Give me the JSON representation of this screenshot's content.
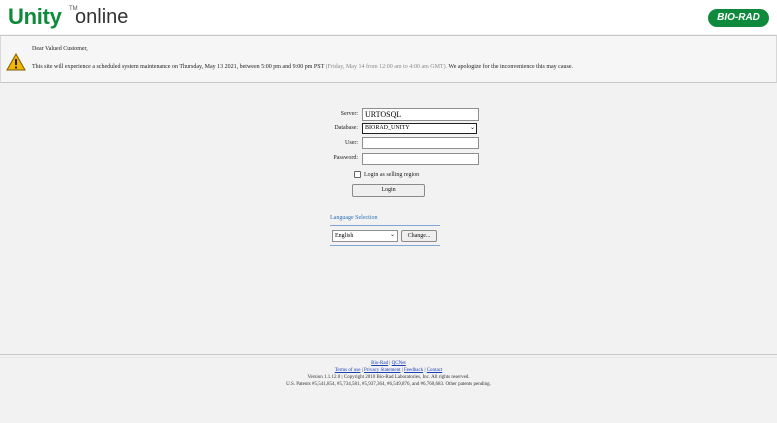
{
  "header": {
    "brand": "Unity",
    "trademark": "TM",
    "suffix": "online",
    "partner_logo": "BIO-RAD"
  },
  "notice": {
    "icon": "warning-icon",
    "greeting": "Dear Valued Customer,",
    "message": "This site will experience a scheduled system maintenance on Thursday, May 13 2021, between 5:00 pm and 9:00 pm PST",
    "gmt_note": "(Friday, May 14 from 12:00 am to 4:00 am GMT).",
    "apology": "We apologize for the inconvenience this may cause."
  },
  "login": {
    "server_label": "Server:",
    "server_value": "URTOSQL",
    "database_label": "Database:",
    "database_value": "BIORAD_UNITY",
    "user_label": "User:",
    "user_value": "",
    "password_label": "Password:",
    "password_value": "",
    "selling_region_label": "Login as selling region",
    "selling_region_checked": false,
    "login_button": "Login"
  },
  "language": {
    "title": "Language Selection",
    "selected": "English",
    "change_button": "Change..."
  },
  "footer": {
    "links_row1": [
      "Bio-Rad",
      "QCNet"
    ],
    "links_row2": [
      "Terms of use",
      "Privacy Statement",
      "Feedback",
      "Contact"
    ],
    "separator": "|",
    "version": "Version 1.1.12.0 | Copyright 2010 Bio-Rad Laboratories, Inc. All rights reserved.",
    "patents": "U.S. Patents #5,541,854, #5,734,581, #5,937,364, #6,549,876, and #6,760,683. Other patents pending."
  },
  "colors": {
    "brand_green": "#0f8a3c",
    "link_blue": "#1a3fb5",
    "section_blue": "#2a72b8"
  }
}
